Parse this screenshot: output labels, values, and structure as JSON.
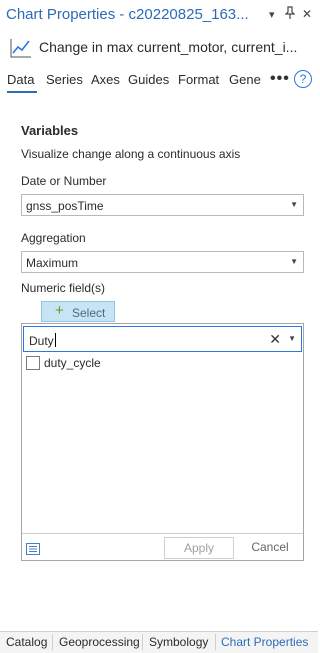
{
  "window": {
    "title": "Chart Properties - c20220825_163...",
    "dropdown_icon": "▾",
    "pin_icon": "pin",
    "close_icon": "✕"
  },
  "chart": {
    "title": "Change in max current_motor, current_i..."
  },
  "tabs": [
    {
      "label": "Data",
      "active": true
    },
    {
      "label": "Series"
    },
    {
      "label": "Axes"
    },
    {
      "label": "Guides"
    },
    {
      "label": "Format"
    },
    {
      "label": "Gene"
    }
  ],
  "more_label": "•••",
  "help_label": "?",
  "variables": {
    "heading": "Variables",
    "description": "Visualize change along a continuous axis",
    "date_label": "Date or Number",
    "date_value": "gnss_posTime",
    "aggregation_label": "Aggregation",
    "aggregation_value": "Maximum",
    "numeric_label": "Numeric field(s)",
    "select_label": "Select"
  },
  "picker": {
    "search_value": "Duty",
    "clear_icon": "✕",
    "options": [
      {
        "label": "duty_cycle",
        "checked": false
      }
    ],
    "apply_label": "Apply",
    "cancel_label": "Cancel"
  },
  "bottom_tabs": [
    {
      "label": "Catalog"
    },
    {
      "label": "Geoprocessing"
    },
    {
      "label": "Symbology"
    },
    {
      "label": "Chart Properties",
      "active": true
    }
  ],
  "colors": {
    "accent": "#2b6cb8",
    "select_button_bg": "#c6e4f3",
    "plus_green": "#5aa02c"
  }
}
